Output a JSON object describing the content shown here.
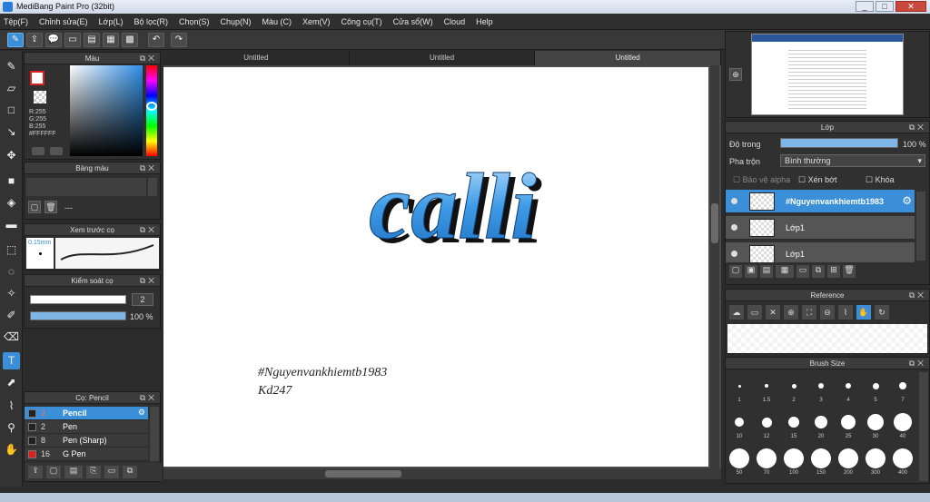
{
  "window": {
    "title": "MediBang Paint Pro (32bit)",
    "minimize": "_",
    "maximize": "□",
    "close": "✕"
  },
  "menu": [
    "Tệp(F)",
    "Chỉnh sửa(E)",
    "Lớp(L)",
    "Bộ lọc(R)",
    "Chọn(S)",
    "Chụp(N)",
    "Màu (C)",
    "Xem(V)",
    "Công cụ(T)",
    "Cửa sổ(W)",
    "Cloud",
    "Help"
  ],
  "toolbar": {
    "icons": [
      "brush-mode-icon",
      "save-icon",
      "chat-icon",
      "comment-icon",
      "page-icon",
      "pages-icon",
      "grid-icon",
      "undo-icon",
      "redo-icon"
    ]
  },
  "color_panel": {
    "title": "Màu",
    "r": "R:255",
    "g": "G:255",
    "b": "B:255",
    "hex": "#FFFFFF",
    "fg": "#FFFFFF",
    "hue_color": "#2e8ee6"
  },
  "palette_panel": {
    "title": "Bảng màu",
    "value": "---"
  },
  "brush_preview": {
    "title": "Xem trước cọ",
    "size": "0.15mm"
  },
  "brush_control": {
    "title": "Kiểm soát cọ",
    "size_value": "2",
    "opacity_value": "100 %",
    "opacity_percent": 100
  },
  "brush_list": {
    "title": "Cọ: Pencil",
    "items": [
      {
        "size": "2",
        "name": "Pencil",
        "color": "#222222",
        "selected": true
      },
      {
        "size": "2",
        "name": "Pen",
        "color": "#222222",
        "selected": false
      },
      {
        "size": "8",
        "name": "Pen (Sharp)",
        "color": "#222222",
        "selected": false
      },
      {
        "size": "16",
        "name": "G Pen",
        "color": "#e02020",
        "selected": false
      }
    ]
  },
  "tabs": [
    "Untitled",
    "Untitled",
    "Untitled"
  ],
  "canvas": {
    "art_text": "calli",
    "hashtag": "#Nguyenvankhiemtb1983",
    "sign": "Kd247"
  },
  "layer_panel": {
    "title": "Lớp",
    "opacity_label": "Độ trong",
    "opacity_value": "100 %",
    "opacity_percent": 100,
    "blend_label": "Pha trộn",
    "blend_value": "Bình thường",
    "protect_alpha": "Bảo vệ alpha",
    "clipping": "Xén bớt",
    "lock": "Khóa",
    "layers": [
      {
        "name": "#Nguyenvankhiemtb1983",
        "selected": true
      },
      {
        "name": "Lớp1",
        "selected": false
      },
      {
        "name": "Lớp1",
        "selected": false
      }
    ]
  },
  "reference_panel": {
    "title": "Reference"
  },
  "brush_size_panel": {
    "title": "Brush Size",
    "sizes": [
      "1",
      "1.5",
      "2",
      "3",
      "4",
      "5",
      "7",
      "10",
      "12",
      "15",
      "20",
      "25",
      "30",
      "40",
      "50",
      "70",
      "100",
      "150",
      "200",
      "300",
      "400"
    ]
  }
}
